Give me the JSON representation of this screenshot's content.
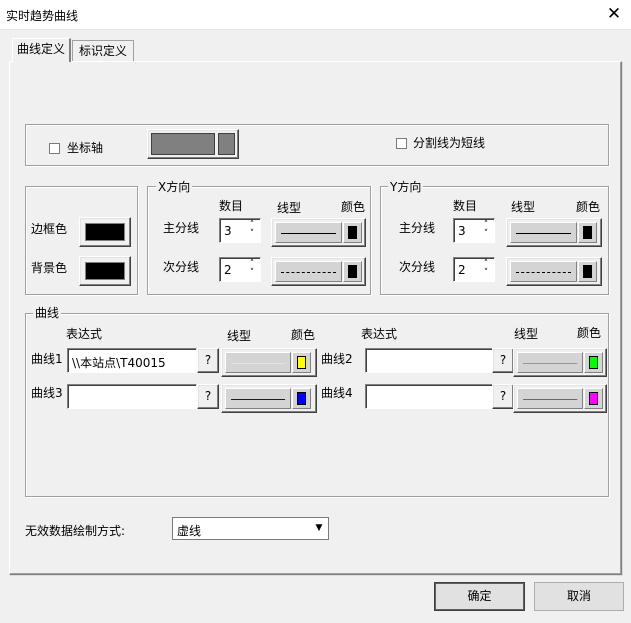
{
  "window": {
    "title": "实时趋势曲线",
    "close_glyph": "✕"
  },
  "tabs": [
    {
      "label": "曲线定义"
    },
    {
      "label": "标识定义"
    }
  ],
  "axis": {
    "checkbox_label": "坐标轴",
    "checked": false,
    "short_divider_label": "分割线为短线",
    "short_divider_checked": false
  },
  "colors_group": {
    "border_label": "边框色",
    "border_color": "#000000",
    "bg_label": "背景色",
    "bg_color": "#000000"
  },
  "x_dir": {
    "title": "X方向",
    "col_count": "数目",
    "col_linetype": "线型",
    "col_color": "颜色",
    "major": {
      "label": "主分线",
      "count": "3",
      "line_style": "solid",
      "color": "#000000"
    },
    "minor": {
      "label": "次分线",
      "count": "2",
      "line_style": "dashed",
      "color": "#000000"
    }
  },
  "y_dir": {
    "title": "Y方向",
    "col_count": "数目",
    "col_linetype": "线型",
    "col_color": "颜色",
    "major": {
      "label": "主分线",
      "count": "3",
      "line_style": "solid",
      "color": "#000000"
    },
    "minor": {
      "label": "次分线",
      "count": "2",
      "line_style": "dashed",
      "color": "#000000"
    }
  },
  "curves": {
    "title": "曲线",
    "col_expr": "表达式",
    "col_linetype": "线型",
    "col_color": "颜色",
    "question": "?",
    "items": [
      {
        "label": "曲线1",
        "expr": "\\\\本站点\\T40015",
        "line_color": "#ffff00"
      },
      {
        "label": "曲线2",
        "expr": "",
        "line_color": "#00ff00"
      },
      {
        "label": "曲线3",
        "expr": "",
        "line_color": "#0000ff"
      },
      {
        "label": "曲线4",
        "expr": "",
        "line_color": "#ff00ff"
      }
    ]
  },
  "invalid_data": {
    "label": "无效数据绘制方式:",
    "value": "虚线",
    "dropdown_glyph": "▼"
  },
  "buttons": {
    "ok": "确定",
    "cancel": "取消"
  },
  "spin_glyphs": {
    "up": "˄",
    "down": "˅"
  }
}
